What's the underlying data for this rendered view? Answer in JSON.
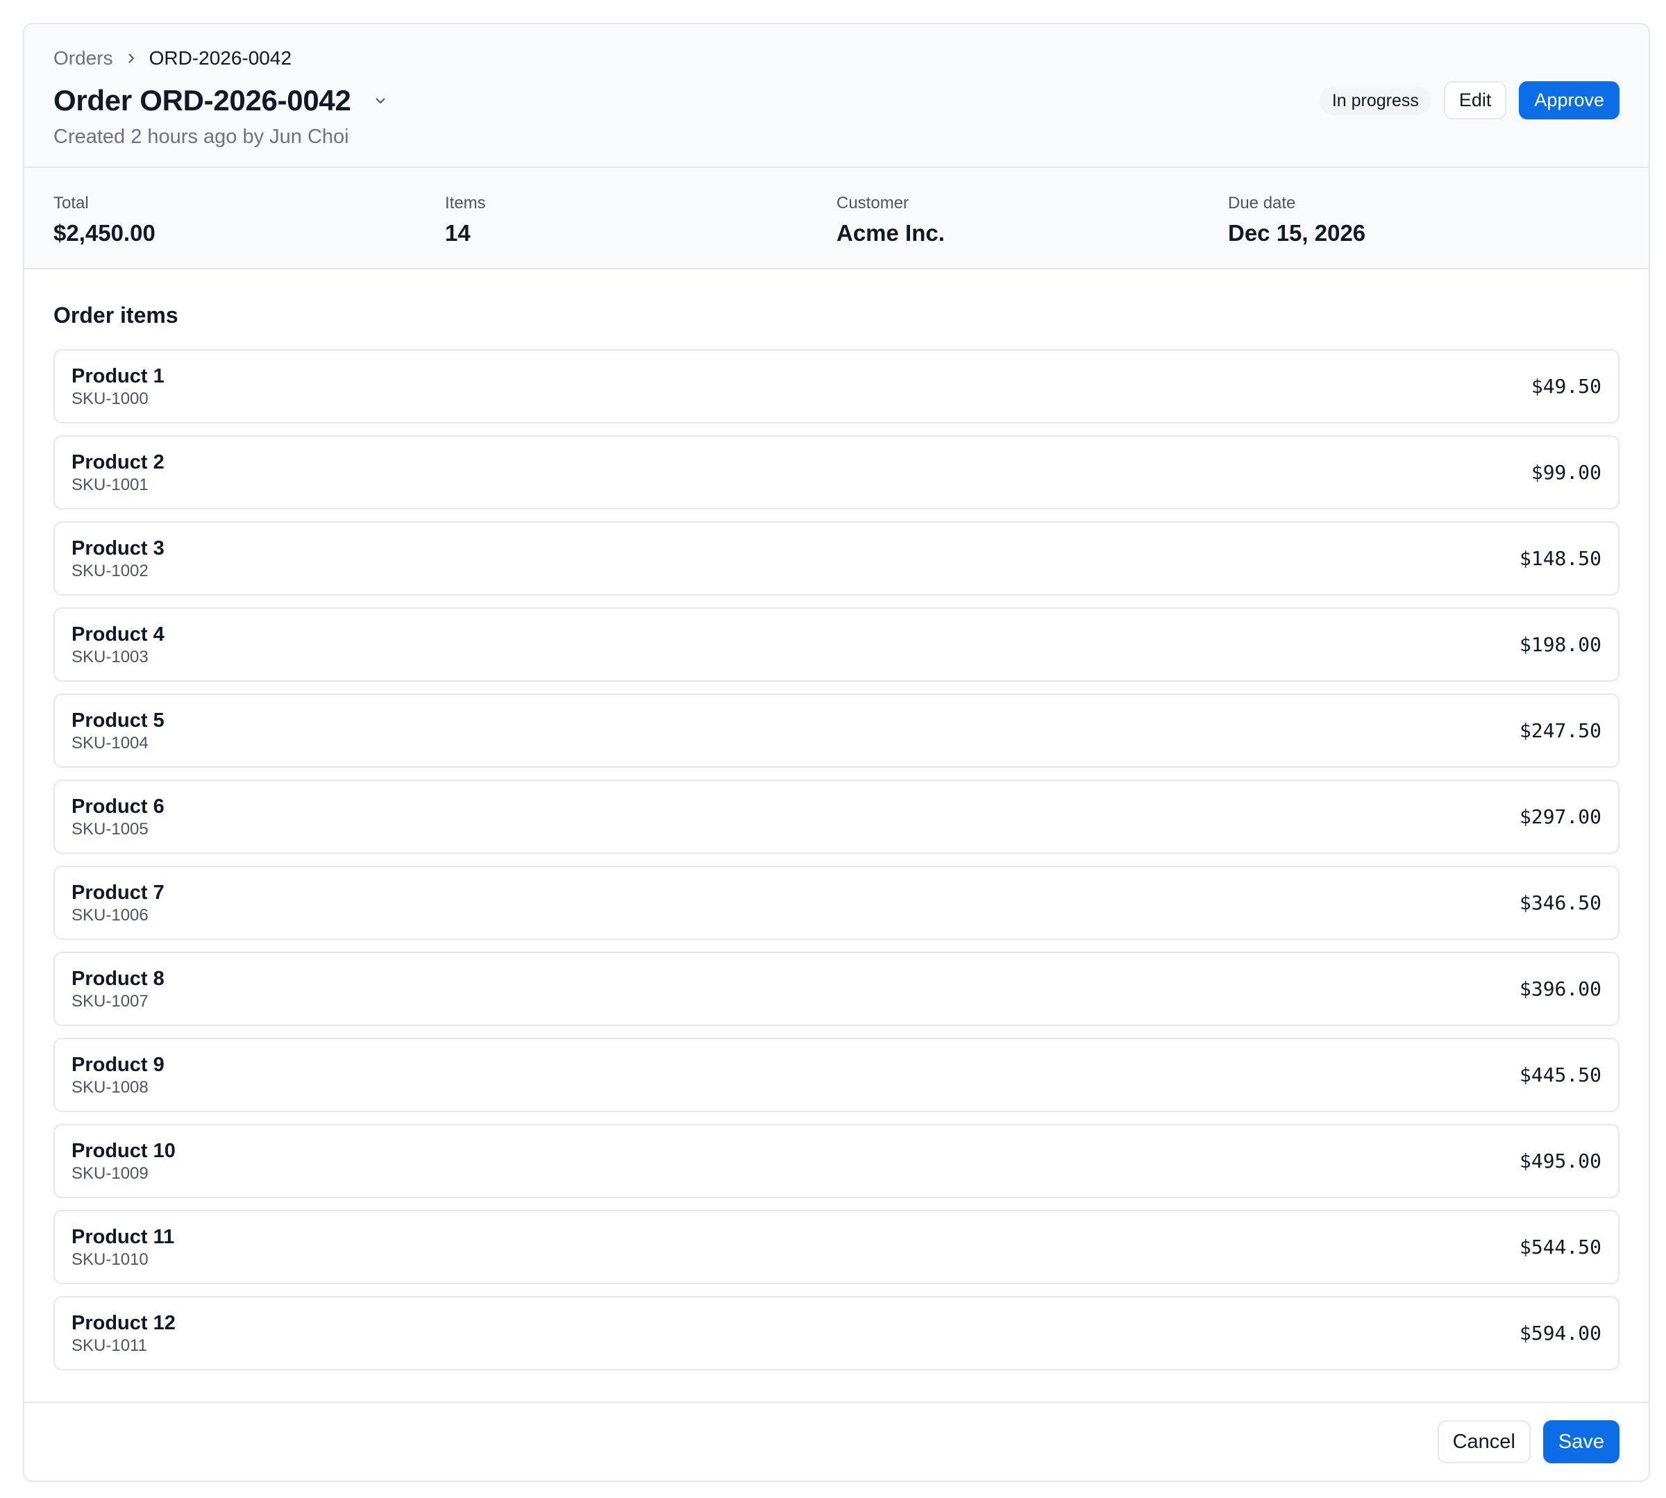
{
  "breadcrumb": {
    "parent": "Orders",
    "current": "ORD-2026-0042"
  },
  "header": {
    "title": "Order ORD-2026-0042",
    "subtitle": "Created 2 hours ago by Jun Choi",
    "status": "In progress",
    "edit_label": "Edit",
    "approve_label": "Approve"
  },
  "stats": [
    {
      "label": "Total",
      "value": "$2,450.00"
    },
    {
      "label": "Items",
      "value": "14"
    },
    {
      "label": "Customer",
      "value": "Acme Inc."
    },
    {
      "label": "Due date",
      "value": "Dec 15, 2026"
    }
  ],
  "order_items": {
    "title": "Order items",
    "items": [
      {
        "name": "Product 1",
        "sku": "SKU-1000",
        "price": "$49.50"
      },
      {
        "name": "Product 2",
        "sku": "SKU-1001",
        "price": "$99.00"
      },
      {
        "name": "Product 3",
        "sku": "SKU-1002",
        "price": "$148.50"
      },
      {
        "name": "Product 4",
        "sku": "SKU-1003",
        "price": "$198.00"
      },
      {
        "name": "Product 5",
        "sku": "SKU-1004",
        "price": "$247.50"
      },
      {
        "name": "Product 6",
        "sku": "SKU-1005",
        "price": "$297.00"
      },
      {
        "name": "Product 7",
        "sku": "SKU-1006",
        "price": "$346.50"
      },
      {
        "name": "Product 8",
        "sku": "SKU-1007",
        "price": "$396.00"
      },
      {
        "name": "Product 9",
        "sku": "SKU-1008",
        "price": "$445.50"
      },
      {
        "name": "Product 10",
        "sku": "SKU-1009",
        "price": "$495.00"
      },
      {
        "name": "Product 11",
        "sku": "SKU-1010",
        "price": "$544.50"
      },
      {
        "name": "Product 12",
        "sku": "SKU-1011",
        "price": "$594.00"
      }
    ]
  },
  "footer": {
    "cancel_label": "Cancel",
    "save_label": "Save"
  },
  "icons": {
    "breadcrumb_separator": "chevron-right-icon",
    "title_menu": "chevron-down-icon"
  },
  "colors": {
    "primary": "#0b6ee6",
    "header_bg": "#f9fafb",
    "border": "#e5e7eb",
    "badge_bg": "#f3f4f6"
  }
}
